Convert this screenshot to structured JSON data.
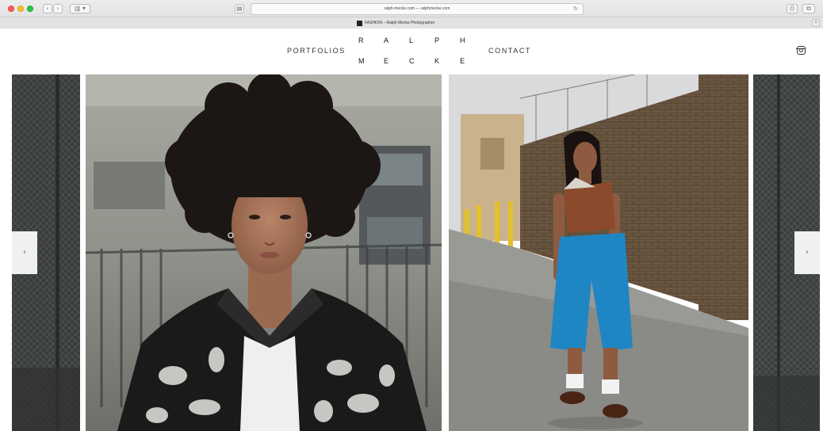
{
  "browser": {
    "url": "ralph-meckе.com — ralphmecke.com",
    "tab_title": "FASHION – Ralph Mecke Photographer",
    "back_label": "‹",
    "forward_label": "›",
    "sidebar_label": "▥ ▾",
    "share_label": "⎙",
    "tabs_label": "⧉",
    "new_tab_label": "+"
  },
  "site": {
    "nav_portfolios": "PORTFOLIOS",
    "nav_contact": "CONTACT",
    "logo_top": [
      "R",
      "A",
      "L",
      "P",
      "H"
    ],
    "logo_bottom": [
      "M",
      "E",
      "C",
      "K",
      "E"
    ]
  },
  "gallery": {
    "prev_label": "‹",
    "next_label": "›"
  },
  "colors": {
    "accent_blue": "#1f86c4",
    "leather": "#8b4a2b",
    "brick": "#6a5640"
  }
}
